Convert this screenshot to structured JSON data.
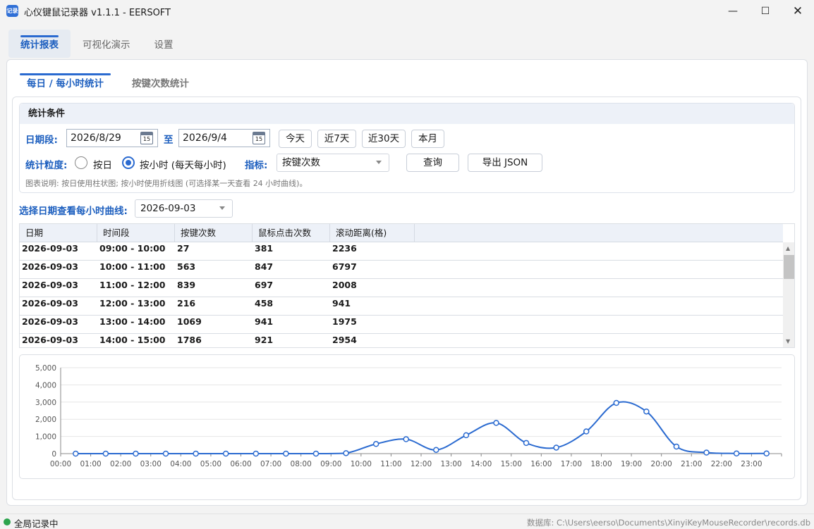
{
  "window": {
    "title": "心仪键鼠记录器 v1.1.1 - EERSOFT",
    "icon_text": "记录"
  },
  "main_tabs": [
    "统计报表",
    "可视化演示",
    "设置"
  ],
  "sub_tabs": [
    "每日 / 每小时统计",
    "按键次数统计"
  ],
  "criteria": {
    "header": "统计条件",
    "date_label": "日期段:",
    "start_date": "2026/8/29",
    "to_label": "至",
    "end_date": "2026/9/4",
    "calendar_day": "15",
    "quick_buttons": [
      "今天",
      "近7天",
      "近30天",
      "本月"
    ],
    "granularity_label": "统计粒度:",
    "radio_day": "按日",
    "radio_hour": "按小时 (每天每小时)",
    "metric_label": "指标:",
    "metric_value": "按键次数",
    "query_button": "查询",
    "export_button": "导出 JSON",
    "note": "图表说明: 按日使用柱状图; 按小时使用折线图 (可选择某一天查看 24 小时曲线)。"
  },
  "day_select": {
    "label": "选择日期查看每小时曲线:",
    "value": "2026-09-03"
  },
  "table": {
    "headers": [
      "日期",
      "时间段",
      "按键次数",
      "鼠标点击次数",
      "滚动距离(格)"
    ],
    "rows": [
      [
        "2026-09-03",
        "09:00 - 10:00",
        "27",
        "381",
        "2236"
      ],
      [
        "2026-09-03",
        "10:00 - 11:00",
        "563",
        "847",
        "6797"
      ],
      [
        "2026-09-03",
        "11:00 - 12:00",
        "839",
        "697",
        "2008"
      ],
      [
        "2026-09-03",
        "12:00 - 13:00",
        "216",
        "458",
        "941"
      ],
      [
        "2026-09-03",
        "13:00 - 14:00",
        "1069",
        "941",
        "1975"
      ],
      [
        "2026-09-03",
        "14:00 - 15:00",
        "1786",
        "921",
        "2954"
      ]
    ]
  },
  "chart_data": {
    "type": "line",
    "x": [
      "00:00",
      "01:00",
      "02:00",
      "03:00",
      "04:00",
      "05:00",
      "06:00",
      "07:00",
      "08:00",
      "09:00",
      "10:00",
      "11:00",
      "12:00",
      "13:00",
      "14:00",
      "15:00",
      "16:00",
      "17:00",
      "18:00",
      "19:00",
      "20:00",
      "21:00",
      "22:00",
      "23:00"
    ],
    "y_ticks": [
      "0",
      "1,000",
      "2,000",
      "3,000",
      "4,000",
      "5,000"
    ],
    "ylim": [
      0,
      5000
    ],
    "series": [
      {
        "values": [
          0,
          0,
          0,
          0,
          0,
          0,
          0,
          0,
          0,
          27,
          563,
          839,
          216,
          1069,
          1786,
          620,
          350,
          1290,
          2950,
          2450,
          410,
          60,
          10,
          10
        ]
      }
    ],
    "color": "#2a6ad0",
    "grid": true
  },
  "status": {
    "text": "全局记录中",
    "db_path": "数据库: C:\\Users\\eerso\\Documents\\XinyiKeyMouseRecorder\\records.db",
    "dot_color": "#2da44e"
  }
}
